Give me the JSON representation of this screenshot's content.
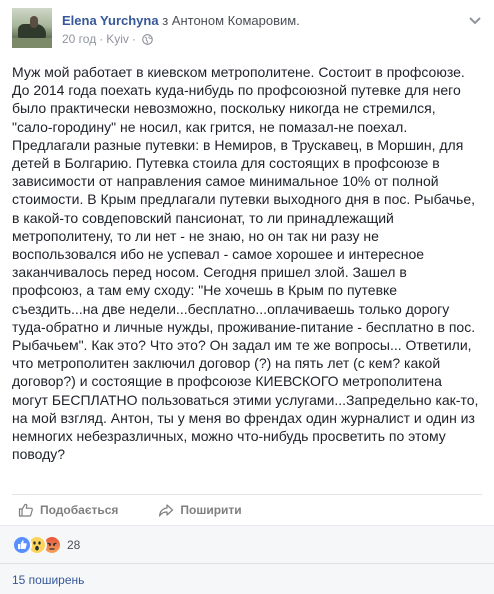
{
  "post": {
    "author": "Elena Yurchyna",
    "with_text": "з Антоном Комаровим.",
    "time": "20 год",
    "location": "Kyiv",
    "separator": "·",
    "body": "Муж мой работает в киевском метрополитене. Состоит в профсоюзе.\nДо 2014 года поехать куда-нибудь по профсоюзной путевке для него\nбыло практически невозможно, поскольку никогда не стремился,\n\"сало-городину\" не носил, как грится, не помазал-не поехал.\nПредлагали разные путевки: в Немиров, в Трускавец, в Моршин, для\nдетей в Болгарию. Путевка стоила для состоящих в профсоюзе в\nзависимости от направления самое минимальное 10% от полной\nстоимости. В Крым предлагали путевки выходного дня в пос. Рыбачье,\nв какой-то совдеповский пансионат, то ли принадлежащий\nметрополитену, то ли нет - не знаю, но он так ни разу не\nвоспользовался ибо не успевал - самое хорошее и интересное\nзаканчивалось перед носом. Сегодня пришел злой. Зашел в\nпрофсоюз, а там ему сходу: \"Не хочешь в Крым по путевке\nсъездить...на две недели...бесплатно...оплачиваешь только дорогу\nтуда-обратно и личные нужды, проживание-питание - бесплатно в пос.\nРыбачьем\". Как это? Что это? Он задал им те же вопросы... Ответили,\nчто метрополитен заключил договор (?) на пять лет (с кем? какой\nдоговор?) и состоящие в профсоюзе КИЕВСКОГО метрополитена\nмогут БЕСПЛАТНО пользоваться этими услугами...Запредельно как-то,\nна мой взгляд. Антон, ты у меня во френдах один журналист и один из\nнемногих небезразличных, можно что-нибудь просветить по этому\nповоду?"
  },
  "actions": {
    "like_label": "Подобається",
    "share_label": "Поширити"
  },
  "reactions": {
    "count": "28",
    "types": [
      "like-icon",
      "wow-icon",
      "angry-icon"
    ]
  },
  "shares": {
    "label": "15 поширень"
  },
  "colors": {
    "link": "#365899",
    "text": "#1d2129",
    "muted": "#90949c",
    "like_blue": "#5890ff"
  }
}
